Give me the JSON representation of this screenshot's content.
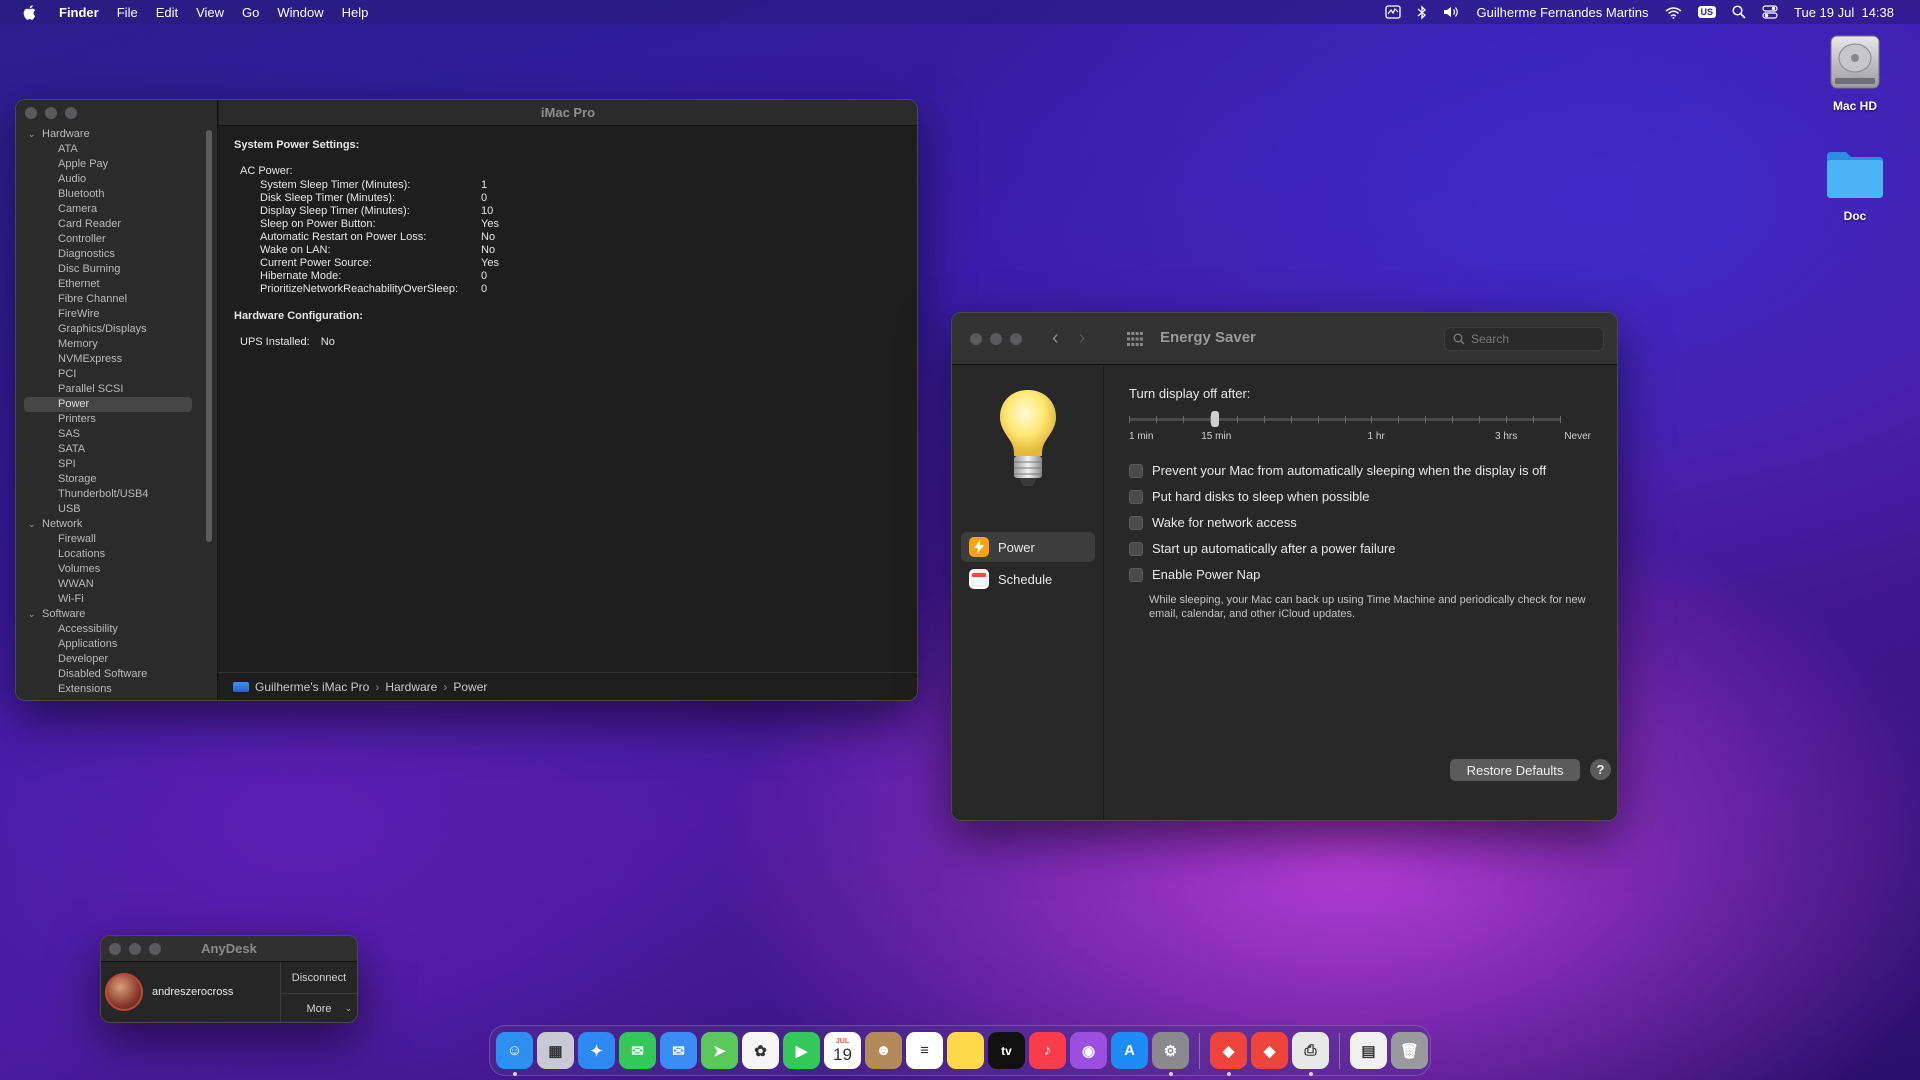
{
  "menubar": {
    "app": "Finder",
    "items": [
      "File",
      "Edit",
      "View",
      "Go",
      "Window",
      "Help"
    ],
    "keyboard_badge": "US",
    "user": "Guilherme Fernandes Martins",
    "datetime": "Tue 19 Jul  14:38"
  },
  "desktop": {
    "icons": [
      {
        "label": "Mac HD",
        "icon": "hard-drive-icon"
      },
      {
        "label": "Doc",
        "icon": "folder-icon"
      }
    ]
  },
  "sysinfo": {
    "title": "iMac Pro",
    "sidebar": {
      "hardware": {
        "label": "Hardware",
        "items": [
          "ATA",
          "Apple Pay",
          "Audio",
          "Bluetooth",
          "Camera",
          "Card Reader",
          "Controller",
          "Diagnostics",
          "Disc Burning",
          "Ethernet",
          "Fibre Channel",
          "FireWire",
          "Graphics/Displays",
          "Memory",
          "NVMExpress",
          "PCI",
          "Parallel SCSI",
          "Power",
          "Printers",
          "SAS",
          "SATA",
          "SPI",
          "Storage",
          "Thunderbolt/USB4",
          "USB"
        ]
      },
      "network": {
        "label": "Network",
        "items": [
          "Firewall",
          "Locations",
          "Volumes",
          "WWAN",
          "Wi-Fi"
        ]
      },
      "software": {
        "label": "Software",
        "items": [
          "Accessibility",
          "Applications",
          "Developer",
          "Disabled Software",
          "Extensions"
        ]
      },
      "selected": "Power"
    },
    "content": {
      "heading": "System Power Settings:",
      "ac_label": "AC Power:",
      "ac_rows": [
        {
          "k": "System Sleep Timer (Minutes):",
          "v": "1"
        },
        {
          "k": "Disk Sleep Timer (Minutes):",
          "v": "0"
        },
        {
          "k": "Display Sleep Timer (Minutes):",
          "v": "10"
        },
        {
          "k": "Sleep on Power Button:",
          "v": "Yes"
        },
        {
          "k": "Automatic Restart on Power Loss:",
          "v": "No"
        },
        {
          "k": "Wake on LAN:",
          "v": "No"
        },
        {
          "k": "Current Power Source:",
          "v": "Yes"
        },
        {
          "k": "Hibernate Mode:",
          "v": "0"
        },
        {
          "k": "PrioritizeNetworkReachabilityOverSleep:",
          "v": "0"
        }
      ],
      "hw_heading": "Hardware Configuration:",
      "ups_label": "UPS Installed:",
      "ups_value": "No"
    },
    "pathbar": [
      "Guilherme's iMac Pro",
      "Hardware",
      "Power"
    ]
  },
  "energy": {
    "title": "Energy Saver",
    "search_placeholder": "Search",
    "nav": [
      {
        "label": "Power",
        "selected": true,
        "color": "#f7a21b"
      },
      {
        "label": "Schedule",
        "selected": false,
        "color": "#ffffff"
      }
    ],
    "display_off_label": "Turn display off after:",
    "slider": {
      "tick_labels": [
        "1 min",
        "15 min",
        "1 hr",
        "3 hrs",
        "Never"
      ],
      "tick_count": 17,
      "value_position": 0.2
    },
    "options": [
      {
        "label": "Prevent your Mac from automatically sleeping when the display is off",
        "checked": false
      },
      {
        "label": "Put hard disks to sleep when possible",
        "checked": false
      },
      {
        "label": "Wake for network access",
        "checked": false
      },
      {
        "label": "Start up automatically after a power failure",
        "checked": false
      },
      {
        "label": "Enable Power Nap",
        "checked": false
      }
    ],
    "power_nap_note": "While sleeping, your Mac can back up using Time Machine and periodically check for new email, calendar, and other iCloud updates.",
    "restore_label": "Restore Defaults",
    "help_label": "?"
  },
  "anydesk": {
    "title": "AnyDesk",
    "user": "andreszerocross",
    "disconnect_label": "Disconnect",
    "more_label": "More"
  },
  "dock": {
    "calendar_month": "JUL",
    "calendar_day": "19",
    "tv_label": "tv",
    "apps": [
      {
        "name": "finder-icon",
        "color": "#2f8ff0"
      },
      {
        "name": "launchpad-icon",
        "color": "#c9c9d6"
      },
      {
        "name": "safari-icon",
        "color": "#2e89f2"
      },
      {
        "name": "messages-icon",
        "color": "#34c759"
      },
      {
        "name": "mail-icon",
        "color": "#3b8cf5"
      },
      {
        "name": "maps-icon",
        "color": "#5ac85a"
      },
      {
        "name": "photos-icon",
        "color": "#f5f5f5"
      },
      {
        "name": "facetime-icon",
        "color": "#34c759"
      },
      {
        "name": "calendar-icon",
        "color": "#ffffff"
      },
      {
        "name": "contacts-icon",
        "color": "#b48a5a"
      },
      {
        "name": "reminders-icon",
        "color": "#ffffff"
      },
      {
        "name": "notes-icon",
        "color": "#ffd94a"
      },
      {
        "name": "appletv-icon",
        "color": "#111111"
      },
      {
        "name": "music-icon",
        "color": "#fa3c4c"
      },
      {
        "name": "podcasts-icon",
        "color": "#9b4ee0"
      },
      {
        "name": "appstore-icon",
        "color": "#1d8cf5"
      },
      {
        "name": "system-preferences-icon",
        "color": "#8a8a8e"
      },
      {
        "name": "anydesk-icon",
        "color": "#ef443b"
      },
      {
        "name": "anydesk-alt-icon",
        "color": "#ef443b"
      },
      {
        "name": "printer-icon",
        "color": "#e8e8e8"
      },
      {
        "name": "document-icon",
        "color": "#f0f0f0"
      },
      {
        "name": "trash-icon",
        "color": "#9a9a9e"
      }
    ]
  }
}
